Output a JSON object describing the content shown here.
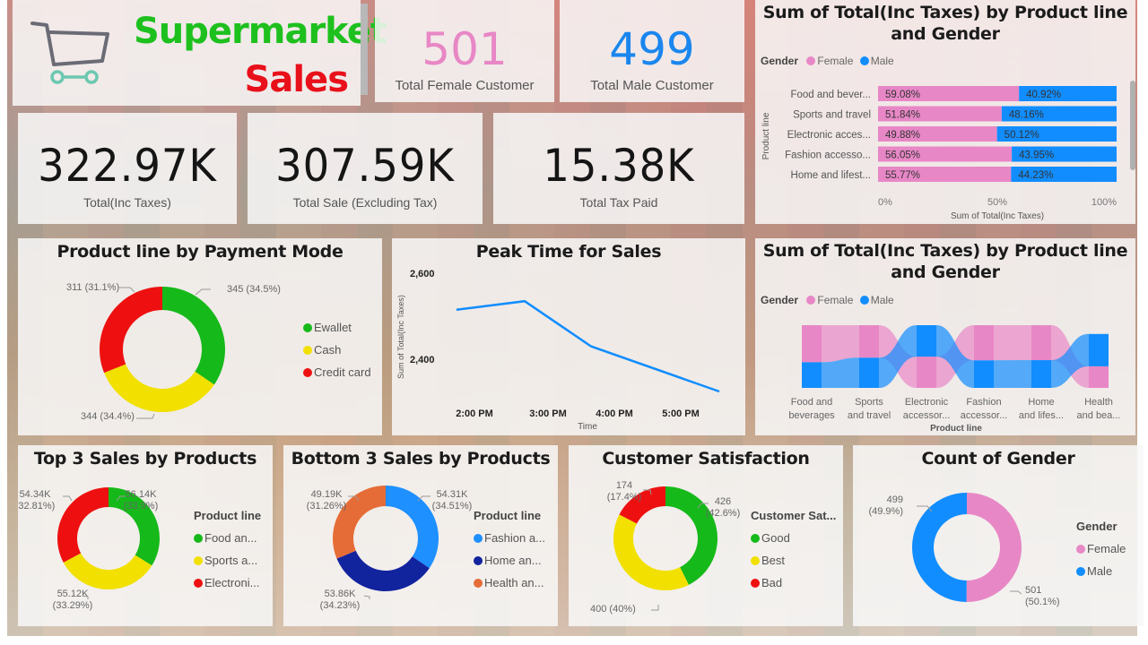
{
  "header": {
    "brand_line1": "Supermarket",
    "brand_line2": "Sales",
    "brand_colors": {
      "line1": "#1ec01e",
      "line2": "#e8101a"
    }
  },
  "kpis_top": [
    {
      "value": "501",
      "label": "Total Female Customer",
      "color": "#e887c6"
    },
    {
      "value": "499",
      "label": "Total Male Customer",
      "color": "#1a86ee"
    }
  ],
  "kpis_main": [
    {
      "value": "322.97K",
      "label": "Total(Inc Taxes)"
    },
    {
      "value": "307.59K",
      "label": "Total Sale (Excluding Tax)"
    },
    {
      "value": "15.38K",
      "label": "Total Tax Paid"
    }
  ],
  "colors": {
    "female": "#e887c6",
    "male": "#118dff",
    "green": "#16b91a",
    "yellow": "#f2e000",
    "red": "#ee1010",
    "light_blue": "#1e90ff",
    "dark_blue": "#12239e",
    "orange": "#e66c37"
  },
  "chart_data": [
    {
      "id": "stacked_bar",
      "type": "bar",
      "subtype": "100%-stacked-horizontal",
      "title": "Sum of Total(Inc Taxes) by Product line and Gender",
      "legend_title": "Gender",
      "legend": [
        "Female",
        "Male"
      ],
      "legend_placement": "top-left",
      "ylabel": "Product line",
      "xlabel": "Sum of Total(Inc Taxes)",
      "x_ticks": [
        "0%",
        "50%",
        "100%"
      ],
      "xlim": [
        0,
        100
      ],
      "categories": [
        "Food and bever...",
        "Sports and travel",
        "Electronic acces...",
        "Fashion accesso...",
        "Home and lifest..."
      ],
      "series": [
        {
          "name": "Female",
          "values": [
            59.08,
            51.84,
            49.88,
            56.05,
            55.77
          ],
          "labels": [
            "59.08%",
            "51.84%",
            "49.88%",
            "56.05%",
            "55.77%"
          ]
        },
        {
          "name": "Male",
          "values": [
            40.92,
            48.16,
            50.12,
            43.95,
            44.23
          ],
          "labels": [
            "40.92%",
            "48.16%",
            "50.12%",
            "43.95%",
            "44.23%"
          ]
        }
      ]
    },
    {
      "id": "ribbon",
      "type": "area",
      "subtype": "ribbon",
      "title": "Sum of Total(Inc Taxes) by Product line and Gender",
      "legend_title": "Gender",
      "legend": [
        "Female",
        "Male"
      ],
      "legend_placement": "top-left",
      "xlabel": "Product line",
      "categories": [
        "Food and beverages",
        "Sports and travel",
        "Electronic accessor...",
        "Fashion accessor...",
        "Home and lifes...",
        "Health and bea..."
      ],
      "category_lines": [
        [
          "Food and",
          "beverages"
        ],
        [
          "Sports",
          "and travel"
        ],
        [
          "Electronic",
          "accessor..."
        ],
        [
          "Fashion",
          "accessor..."
        ],
        [
          "Home",
          "and lifes..."
        ],
        [
          "Health",
          "and bea..."
        ]
      ],
      "series": [
        {
          "name": "Female",
          "values": [
            59.08,
            51.84,
            49.88,
            56.05,
            55.77,
            40.0
          ]
        },
        {
          "name": "Male",
          "values": [
            40.92,
            48.16,
            50.12,
            43.95,
            44.23,
            60.0
          ]
        }
      ],
      "top_series": [
        "Female",
        "Female",
        "Male",
        "Female",
        "Female",
        "Male"
      ]
    },
    {
      "id": "payment_donut",
      "type": "pie",
      "subtype": "donut",
      "title": "Product line by Payment Mode",
      "legend": [
        "Ewallet",
        "Cash",
        "Credit card"
      ],
      "legend_placement": "right",
      "values": [
        345,
        344,
        311
      ],
      "labels": [
        "345 (34.5%)",
        "344 (34.4%)",
        "311 (31.1%)"
      ],
      "colors": [
        "#16b91a",
        "#f2e000",
        "#ee1010"
      ]
    },
    {
      "id": "peak_time",
      "type": "line",
      "title": "Peak Time for Sales",
      "xlabel": "Time",
      "ylabel": "Sum of Total(Inc Taxes)",
      "x": [
        "2:00 PM",
        "3:00 PM",
        "4:00 PM",
        "5:00 PM"
      ],
      "values": [
        2515,
        2535,
        2430,
        2325
      ],
      "y_ticks": [
        "2,600",
        "2,400"
      ],
      "y_tick_values": [
        2600,
        2400
      ],
      "color": "#118dff"
    },
    {
      "id": "top3",
      "type": "pie",
      "subtype": "donut",
      "title": "Top 3 Sales by Products",
      "legend_title": "Product line",
      "legend": [
        "Food an...",
        "Sports a...",
        "Electroni..."
      ],
      "legend_placement": "right",
      "values": [
        56.14,
        55.12,
        54.34
      ],
      "labels": [
        [
          "56.14K",
          "(33.9%)"
        ],
        [
          "55.12K",
          "(33.29%)"
        ],
        [
          "54.34K",
          "(32.81%)"
        ]
      ],
      "colors": [
        "#16b91a",
        "#f2e000",
        "#ee1010"
      ]
    },
    {
      "id": "bottom3",
      "type": "pie",
      "subtype": "donut",
      "title": "Bottom 3 Sales by Products",
      "legend_title": "Product line",
      "legend": [
        "Fashion a...",
        "Home an...",
        "Health an..."
      ],
      "legend_placement": "right",
      "values": [
        54.31,
        53.86,
        49.19
      ],
      "labels": [
        [
          "54.31K",
          "(34.51%)"
        ],
        [
          "53.86K",
          "(34.23%)"
        ],
        [
          "49.19K",
          "(31.26%)"
        ]
      ],
      "colors": [
        "#1e90ff",
        "#12239e",
        "#e66c37"
      ]
    },
    {
      "id": "satisfaction",
      "type": "pie",
      "subtype": "donut",
      "title": "Customer Satisfaction",
      "legend_title": "Customer Sat...",
      "legend": [
        "Good",
        "Best",
        "Bad"
      ],
      "legend_placement": "right",
      "values": [
        426,
        400,
        174
      ],
      "labels": [
        [
          "426",
          "(42.6%)"
        ],
        [
          "400 (40%)"
        ],
        [
          "174",
          "(17.4%)"
        ]
      ],
      "colors": [
        "#16b91a",
        "#f2e000",
        "#ee1010"
      ]
    },
    {
      "id": "gender_count",
      "type": "pie",
      "subtype": "donut",
      "title": "Count of Gender",
      "legend_title": "Gender",
      "legend": [
        "Female",
        "Male"
      ],
      "legend_placement": "right",
      "values": [
        501,
        499
      ],
      "labels": [
        [
          "501",
          "(50.1%)"
        ],
        [
          "499",
          "(49.9%)"
        ]
      ],
      "colors": [
        "#e887c6",
        "#118dff"
      ]
    }
  ]
}
